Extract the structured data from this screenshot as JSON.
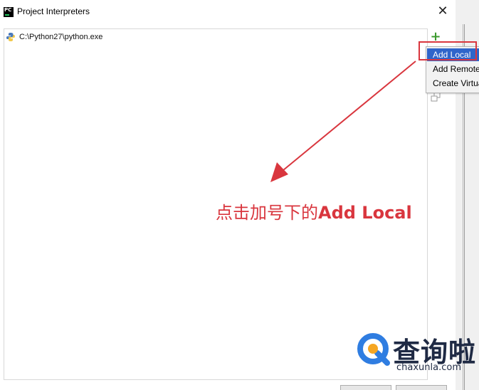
{
  "window": {
    "title": "Project Interpreters"
  },
  "interpreters": {
    "items": [
      {
        "label": "C:\\Python27\\python.exe"
      }
    ]
  },
  "add_menu": {
    "items": [
      {
        "label": "Add Local"
      },
      {
        "label": "Add Remote"
      },
      {
        "label": "Create VirtualEnv"
      }
    ]
  },
  "annotation": {
    "text_cn": "点击加号下的",
    "text_en": "Add Local"
  },
  "watermark": {
    "brand": "查询啦",
    "url": "chaxunla.com"
  },
  "colors": {
    "accent_red": "#d9363e",
    "menu_selected": "#2f65ca",
    "add_green": "#3c9a2f",
    "watermark_blue": "#2f7de1",
    "watermark_orange": "#f5a623"
  },
  "icons": {
    "app": "pycharm-icon",
    "close": "close-icon",
    "add": "plus-icon",
    "copy": "copy-icon",
    "interpreter": "python-icon"
  }
}
